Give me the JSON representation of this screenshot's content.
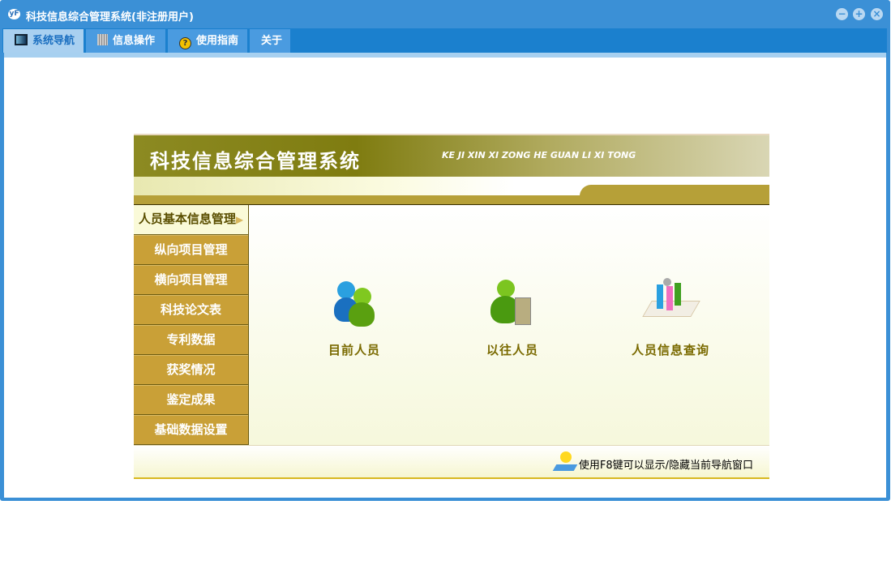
{
  "window": {
    "title": "科技信息综合管理系统(非注册用户)",
    "logo_text": "yF"
  },
  "tabs": [
    {
      "label": "系统导航",
      "icon": "monitor-icon"
    },
    {
      "label": "信息操作",
      "icon": "grid-icon"
    },
    {
      "label": "使用指南",
      "icon": "help-icon"
    },
    {
      "label": "关于"
    }
  ],
  "header": {
    "title": "科技信息综合管理系统",
    "subtitle": "KE JI XIN XI ZONG HE GUAN LI XI TONG"
  },
  "sidebar": {
    "items": [
      {
        "label": "人员基本信息管理",
        "active": true
      },
      {
        "label": "纵向项目管理"
      },
      {
        "label": "横向项目管理"
      },
      {
        "label": "科技论文表"
      },
      {
        "label": "专利数据"
      },
      {
        "label": "获奖情况"
      },
      {
        "label": "鉴定成果"
      },
      {
        "label": "基础数据设置"
      }
    ]
  },
  "main": {
    "items": [
      {
        "label": "目前人员",
        "icon": "current-people-icon"
      },
      {
        "label": "以往人员",
        "icon": "former-people-icon"
      },
      {
        "label": "人员信息查询",
        "icon": "people-query-icon"
      }
    ]
  },
  "footer": {
    "hint": "使用F8键可以显示/隐藏当前导航窗口"
  }
}
